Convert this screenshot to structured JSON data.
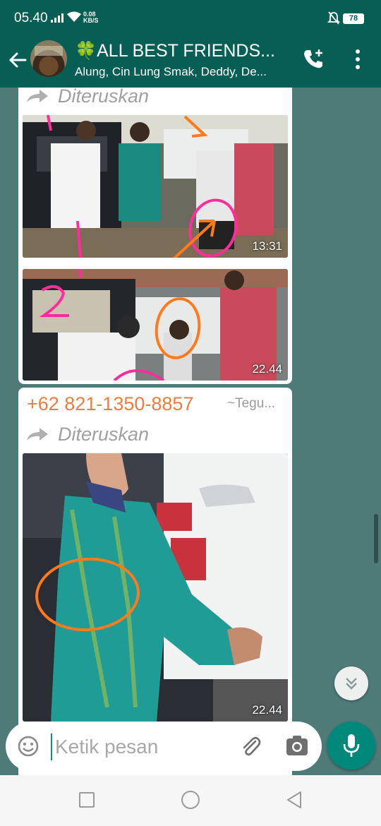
{
  "status_bar": {
    "time": "05.40",
    "net_speed": "0.08",
    "net_unit": "KB/S",
    "battery": "78"
  },
  "header": {
    "title": "🍀ALL BEST FRIENDS...",
    "members": "Alung, Cin Lung Smak, Deddy, De..."
  },
  "messages": [
    {
      "forwarded_label": "Diteruskan",
      "photos": [
        {
          "time": "13:31"
        },
        {
          "time": "22.44"
        }
      ],
      "annotations": [
        "1",
        "2"
      ]
    },
    {
      "sender_phone": "+62 821-1350-8857",
      "sender_name": "~Tegu...",
      "forwarded_label": "Diteruskan",
      "photos": [
        {
          "time": "22.44"
        }
      ]
    }
  ],
  "composer": {
    "placeholder": "Ketik pesan"
  },
  "colors": {
    "header_bg": "#075e54",
    "chat_bg": "#4e7a78",
    "accent": "#00897b",
    "sender_color": "#f07b3f",
    "annotation_pink": "#ff2d9b",
    "annotation_orange": "#ff7a1a"
  },
  "icons": [
    "back-arrow-icon",
    "add-call-icon",
    "more-vert-icon",
    "forward-icon",
    "emoji-icon",
    "attach-icon",
    "camera-icon",
    "mic-icon",
    "scroll-down-icon"
  ]
}
